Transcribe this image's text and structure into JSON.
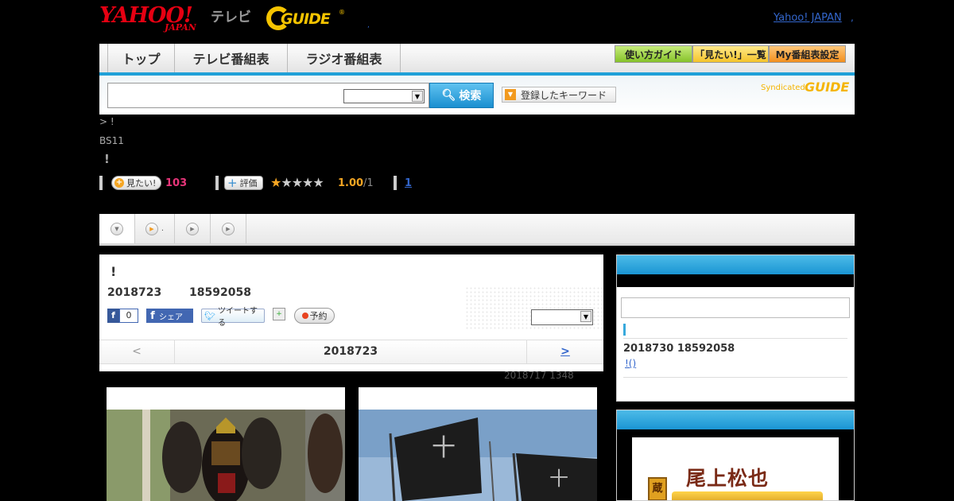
{
  "header": {
    "logo_yahoo_top": "YAHOO!",
    "logo_yahoo_sub": "JAPAN",
    "logo_tv": "テレビ",
    "logo_gguide": "GUIDE",
    "logo_reg": "®",
    "tiny_dot": ",",
    "yahoo_japan_link": "Yahoo! JAPAN",
    "yahoo_japan_dot": ","
  },
  "nav": {
    "tabs": [
      "トップ",
      "テレビ番組表",
      "ラジオ番組表"
    ],
    "buttons": [
      "使い方ガイド",
      "「見たい!」一覧",
      "My番組表設定"
    ]
  },
  "search": {
    "input_value": "",
    "select_value": "",
    "button_label": "検索",
    "keyword_button": "登録したキーワード",
    "syndicated": "Syndicated",
    "gguide_mark": "GUIDE"
  },
  "program": {
    "breadcrumb": "> !",
    "channel": "BS11",
    "title": "!",
    "want_label": "見たい!",
    "want_count": "103",
    "rate_label": "評価",
    "stars_filled": 1,
    "stars_total": 5,
    "rating": "1.00",
    "rating_count": "/1",
    "review_link": "1"
  },
  "tabs": [
    {
      "icon": "chevron-down",
      "label": ""
    },
    {
      "icon": "play",
      "label": "."
    },
    {
      "icon": "play",
      "label": ""
    },
    {
      "icon": "play",
      "label": ""
    }
  ],
  "panel": {
    "title": "!",
    "date": "2018723",
    "time": "18592058",
    "fb_like_count": "0",
    "fb_share": "シェア",
    "tweet": "ツイートする",
    "record": "予約",
    "nav_prev": "<",
    "nav_date": "2018723",
    "nav_next": ">",
    "updated": "2018717  1348"
  },
  "sidebar": {
    "search_value": "",
    "next_date": "2018730  18592058",
    "next_link": "!()"
  },
  "ad": {
    "text": "尾上松也",
    "kura": "蔵"
  }
}
